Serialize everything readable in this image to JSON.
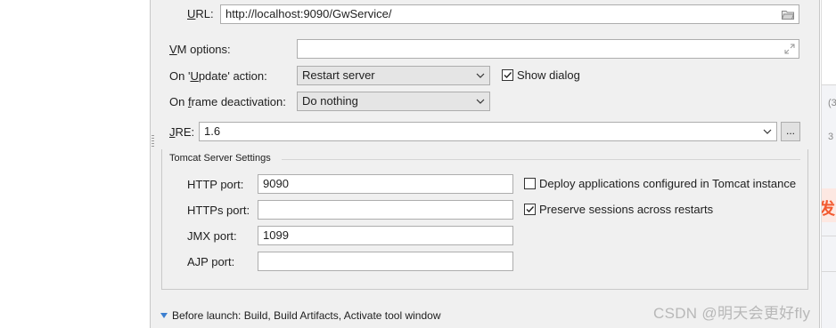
{
  "url": {
    "label": "URL:",
    "value": "http://localhost:9090/GwService/"
  },
  "vm_options": {
    "label": "VM options:",
    "value": ""
  },
  "update_action": {
    "label": "On 'Update' action:",
    "selected": "Restart server"
  },
  "show_dialog": {
    "label": "Show dialog",
    "checked": true
  },
  "frame_deactivation": {
    "label": "On frame deactivation:",
    "selected": "Do nothing"
  },
  "jre": {
    "label": "JRE:",
    "value": "1.6",
    "browse_label": "..."
  },
  "tomcat": {
    "title": "Tomcat Server Settings",
    "http_port": {
      "label": "HTTP port:",
      "value": "9090"
    },
    "https_port": {
      "label": "HTTPs port:",
      "value": ""
    },
    "jmx_port": {
      "label": "JMX port:",
      "value": "1099"
    },
    "ajp_port": {
      "label": "AJP port:",
      "value": ""
    },
    "deploy_apps": {
      "label": "Deploy applications configured in Tomcat instance",
      "checked": false
    },
    "preserve_sessions": {
      "label": "Preserve sessions across restarts",
      "checked": true
    }
  },
  "before_launch": {
    "label": "Before launch: Build, Build Artifacts, Activate tool window"
  },
  "right_panel": {
    "text_top": "(3",
    "text_mid": "3",
    "badge": "发I"
  },
  "watermark": "CSDN @明天会更好fly",
  "icons": {
    "folder": "folder-icon",
    "expand": "expand-icon",
    "dropdown": "chevron-down-icon",
    "check": "checkmark-icon",
    "disclosure": "triangle-down-icon"
  },
  "colors": {
    "dialog_bg": "#f0f0f0",
    "accent": "#3c7fd0",
    "badge": "#f25a30"
  }
}
